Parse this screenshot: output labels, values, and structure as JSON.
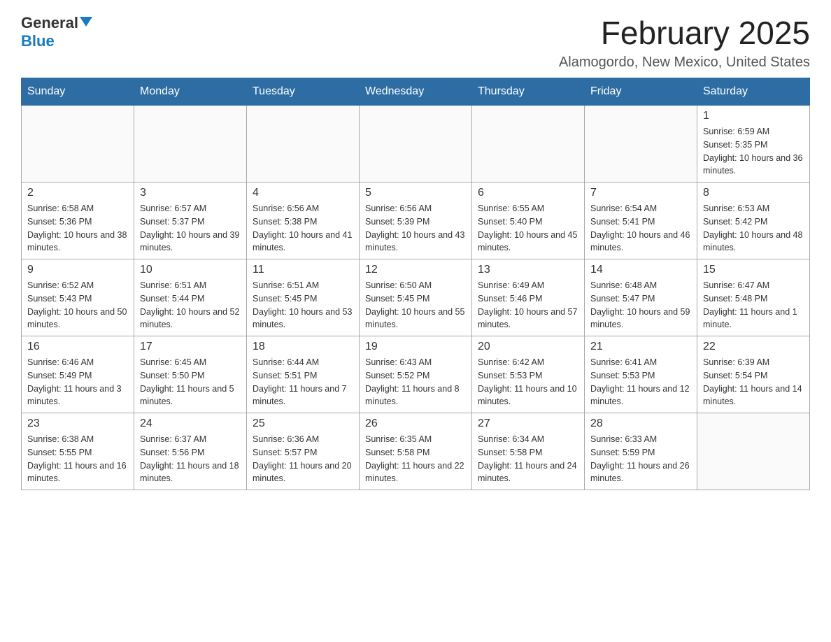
{
  "logo": {
    "general": "General",
    "blue": "Blue"
  },
  "title": "February 2025",
  "subtitle": "Alamogordo, New Mexico, United States",
  "days_header": [
    "Sunday",
    "Monday",
    "Tuesday",
    "Wednesday",
    "Thursday",
    "Friday",
    "Saturday"
  ],
  "weeks": [
    [
      {
        "day": "",
        "info": ""
      },
      {
        "day": "",
        "info": ""
      },
      {
        "day": "",
        "info": ""
      },
      {
        "day": "",
        "info": ""
      },
      {
        "day": "",
        "info": ""
      },
      {
        "day": "",
        "info": ""
      },
      {
        "day": "1",
        "info": "Sunrise: 6:59 AM\nSunset: 5:35 PM\nDaylight: 10 hours and 36 minutes."
      }
    ],
    [
      {
        "day": "2",
        "info": "Sunrise: 6:58 AM\nSunset: 5:36 PM\nDaylight: 10 hours and 38 minutes."
      },
      {
        "day": "3",
        "info": "Sunrise: 6:57 AM\nSunset: 5:37 PM\nDaylight: 10 hours and 39 minutes."
      },
      {
        "day": "4",
        "info": "Sunrise: 6:56 AM\nSunset: 5:38 PM\nDaylight: 10 hours and 41 minutes."
      },
      {
        "day": "5",
        "info": "Sunrise: 6:56 AM\nSunset: 5:39 PM\nDaylight: 10 hours and 43 minutes."
      },
      {
        "day": "6",
        "info": "Sunrise: 6:55 AM\nSunset: 5:40 PM\nDaylight: 10 hours and 45 minutes."
      },
      {
        "day": "7",
        "info": "Sunrise: 6:54 AM\nSunset: 5:41 PM\nDaylight: 10 hours and 46 minutes."
      },
      {
        "day": "8",
        "info": "Sunrise: 6:53 AM\nSunset: 5:42 PM\nDaylight: 10 hours and 48 minutes."
      }
    ],
    [
      {
        "day": "9",
        "info": "Sunrise: 6:52 AM\nSunset: 5:43 PM\nDaylight: 10 hours and 50 minutes."
      },
      {
        "day": "10",
        "info": "Sunrise: 6:51 AM\nSunset: 5:44 PM\nDaylight: 10 hours and 52 minutes."
      },
      {
        "day": "11",
        "info": "Sunrise: 6:51 AM\nSunset: 5:45 PM\nDaylight: 10 hours and 53 minutes."
      },
      {
        "day": "12",
        "info": "Sunrise: 6:50 AM\nSunset: 5:45 PM\nDaylight: 10 hours and 55 minutes."
      },
      {
        "day": "13",
        "info": "Sunrise: 6:49 AM\nSunset: 5:46 PM\nDaylight: 10 hours and 57 minutes."
      },
      {
        "day": "14",
        "info": "Sunrise: 6:48 AM\nSunset: 5:47 PM\nDaylight: 10 hours and 59 minutes."
      },
      {
        "day": "15",
        "info": "Sunrise: 6:47 AM\nSunset: 5:48 PM\nDaylight: 11 hours and 1 minute."
      }
    ],
    [
      {
        "day": "16",
        "info": "Sunrise: 6:46 AM\nSunset: 5:49 PM\nDaylight: 11 hours and 3 minutes."
      },
      {
        "day": "17",
        "info": "Sunrise: 6:45 AM\nSunset: 5:50 PM\nDaylight: 11 hours and 5 minutes."
      },
      {
        "day": "18",
        "info": "Sunrise: 6:44 AM\nSunset: 5:51 PM\nDaylight: 11 hours and 7 minutes."
      },
      {
        "day": "19",
        "info": "Sunrise: 6:43 AM\nSunset: 5:52 PM\nDaylight: 11 hours and 8 minutes."
      },
      {
        "day": "20",
        "info": "Sunrise: 6:42 AM\nSunset: 5:53 PM\nDaylight: 11 hours and 10 minutes."
      },
      {
        "day": "21",
        "info": "Sunrise: 6:41 AM\nSunset: 5:53 PM\nDaylight: 11 hours and 12 minutes."
      },
      {
        "day": "22",
        "info": "Sunrise: 6:39 AM\nSunset: 5:54 PM\nDaylight: 11 hours and 14 minutes."
      }
    ],
    [
      {
        "day": "23",
        "info": "Sunrise: 6:38 AM\nSunset: 5:55 PM\nDaylight: 11 hours and 16 minutes."
      },
      {
        "day": "24",
        "info": "Sunrise: 6:37 AM\nSunset: 5:56 PM\nDaylight: 11 hours and 18 minutes."
      },
      {
        "day": "25",
        "info": "Sunrise: 6:36 AM\nSunset: 5:57 PM\nDaylight: 11 hours and 20 minutes."
      },
      {
        "day": "26",
        "info": "Sunrise: 6:35 AM\nSunset: 5:58 PM\nDaylight: 11 hours and 22 minutes."
      },
      {
        "day": "27",
        "info": "Sunrise: 6:34 AM\nSunset: 5:58 PM\nDaylight: 11 hours and 24 minutes."
      },
      {
        "day": "28",
        "info": "Sunrise: 6:33 AM\nSunset: 5:59 PM\nDaylight: 11 hours and 26 minutes."
      },
      {
        "day": "",
        "info": ""
      }
    ]
  ]
}
